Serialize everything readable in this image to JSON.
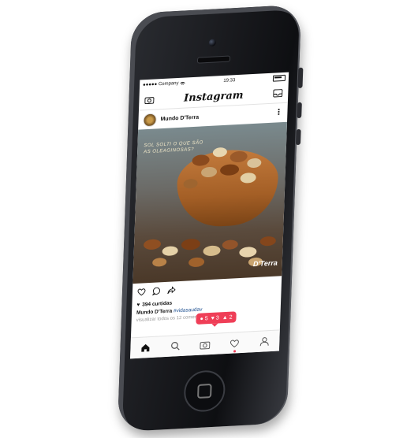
{
  "status_bar": {
    "carrier": "●●●●● Company",
    "wifi_icon": "wifi-icon",
    "time": "19:33",
    "battery_icon": "battery-icon"
  },
  "app": {
    "title": "Instagram"
  },
  "post": {
    "username": "Mundo D'Terra",
    "image_caption_line1": "SOL SOLTI O QUE SÃO",
    "image_caption_line2": "AS OLEAGINOSAS?",
    "image_logo": "D'Terra",
    "likes": "394 curtidas",
    "caption_user": "Mundo D'Terra",
    "caption_hashtag": "#vidasaudav",
    "comments_link": "visualizar todos os 12 comentários"
  },
  "notification": {
    "comments": "5",
    "likes": "3",
    "followers": "2"
  },
  "colors": {
    "accent": "#ef3e57",
    "hashtag": "#1a4d8f",
    "phone": "#1a1b1f"
  }
}
